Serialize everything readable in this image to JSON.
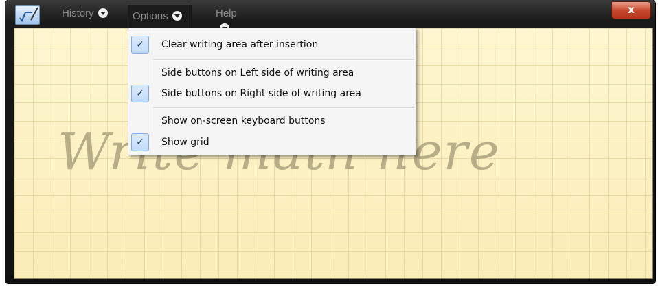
{
  "menubar": {
    "history_label": "History",
    "options_label": "Options",
    "help_label": "Help",
    "close_label": "x"
  },
  "options_menu": {
    "items": [
      {
        "label": "Clear writing area after insertion",
        "checked": true
      },
      {
        "label": "Side buttons on Left side of writing area",
        "checked": false
      },
      {
        "label": "Side buttons on Right side of writing area",
        "checked": true
      },
      {
        "label": "Show on-screen keyboard buttons",
        "checked": false
      },
      {
        "label": "Show grid",
        "checked": true
      }
    ],
    "check_glyph": "✓"
  },
  "writing_area": {
    "placeholder": "Write math here"
  },
  "colors": {
    "pad_background": "#fcf3c8",
    "menu_check_highlight": "#c1dbfc",
    "close_button": "#c74a2f"
  }
}
